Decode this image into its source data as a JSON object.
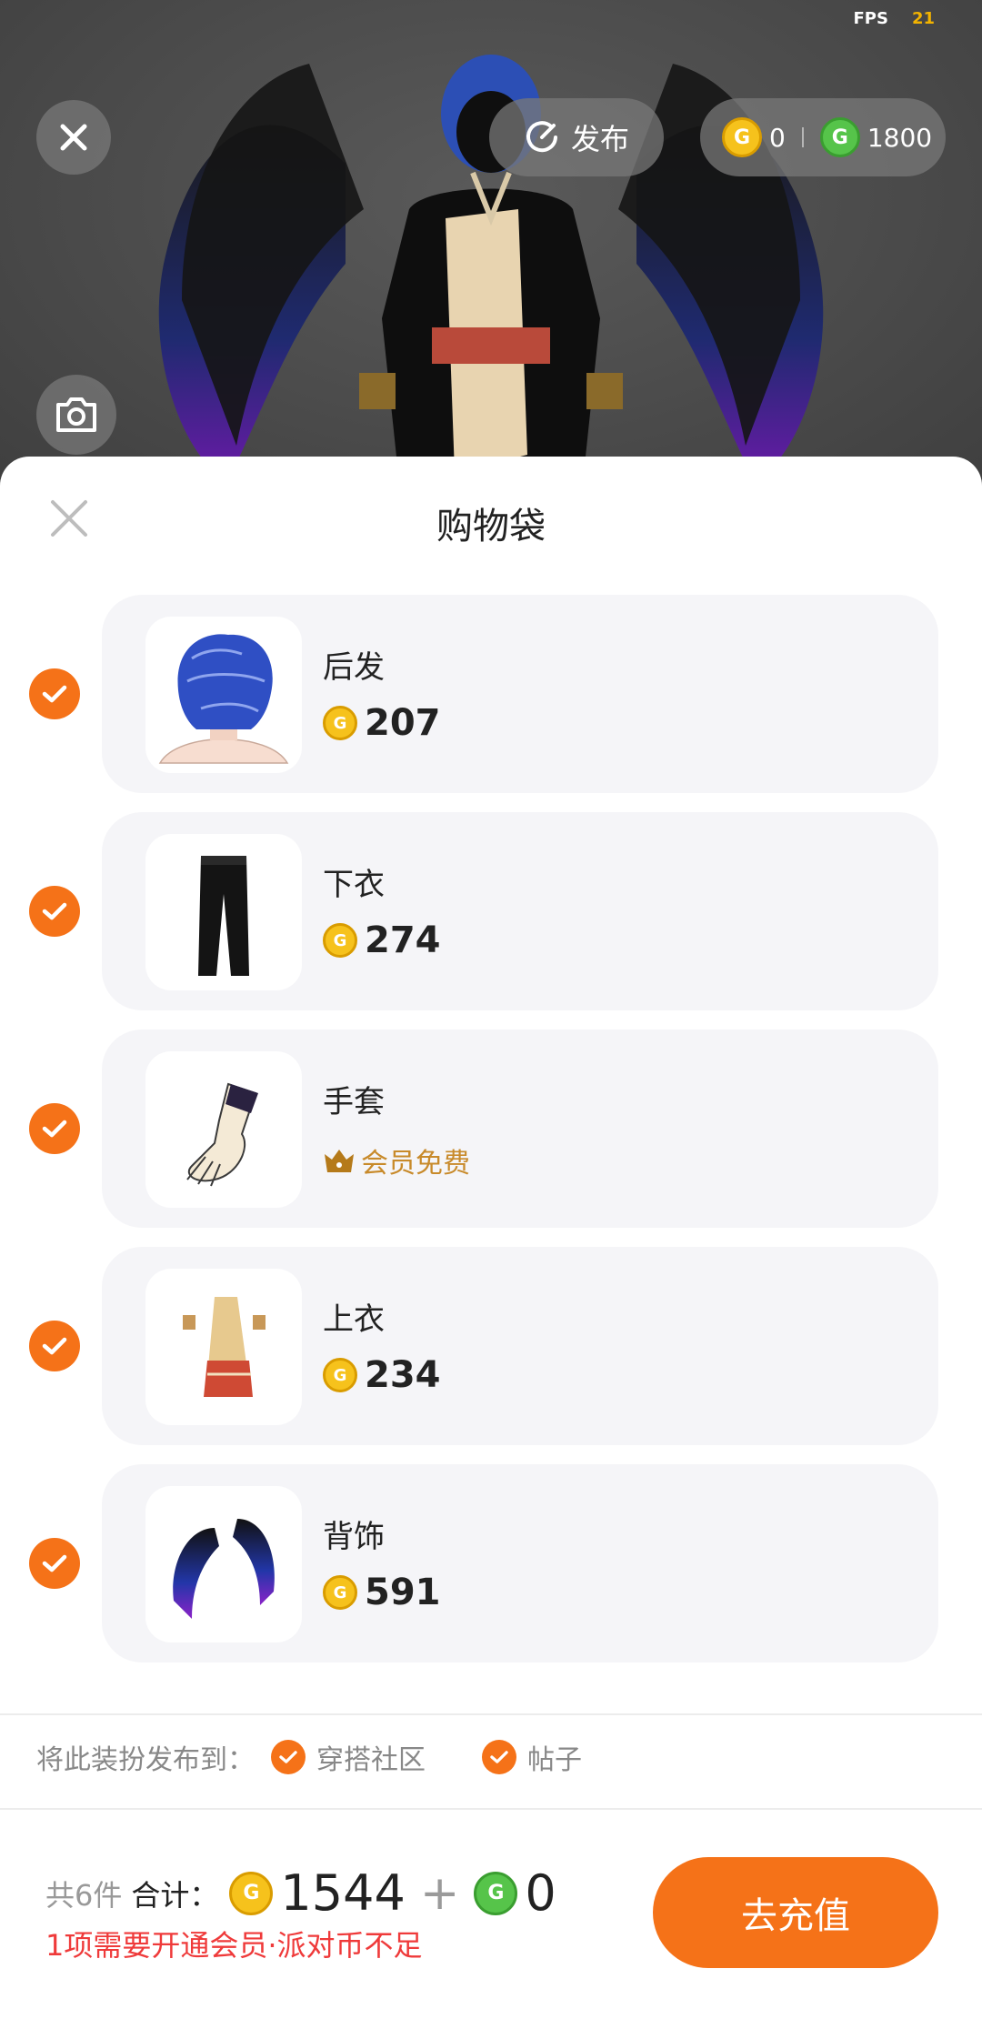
{
  "fps": {
    "label": "FPS",
    "value": "21"
  },
  "top_bar": {
    "publish_label": "发布",
    "gold_balance": "0",
    "green_balance": "1800"
  },
  "sheet": {
    "title": "购物袋",
    "items": [
      {
        "name": "后发",
        "price": "207",
        "kind": "coin",
        "thumb": "hair-icon"
      },
      {
        "name": "下衣",
        "price": "274",
        "kind": "coin",
        "thumb": "pants-icon"
      },
      {
        "name": "手套",
        "vip_label": "会员免费",
        "kind": "vip",
        "thumb": "glove-icon"
      },
      {
        "name": "上衣",
        "price": "234",
        "kind": "coin",
        "thumb": "top-icon"
      },
      {
        "name": "背饰",
        "price": "591",
        "kind": "coin",
        "thumb": "wings-icon"
      }
    ],
    "publish_to": {
      "label": "将此装扮发布到：",
      "options": [
        "穿搭社区",
        "帖子"
      ]
    },
    "footer": {
      "count": "共6件",
      "sum_label": "合计：",
      "gold_total": "1544",
      "plus": "+",
      "green_total": "0",
      "warning": "1项需要开通会员·派对币不足",
      "recharge_label": "去充值"
    }
  },
  "colors": {
    "accent": "#f57218",
    "warning": "#ef3a3a",
    "vip": "#c88a2a",
    "gold_coin": "#f6c21c",
    "green_coin": "#56c44a"
  }
}
